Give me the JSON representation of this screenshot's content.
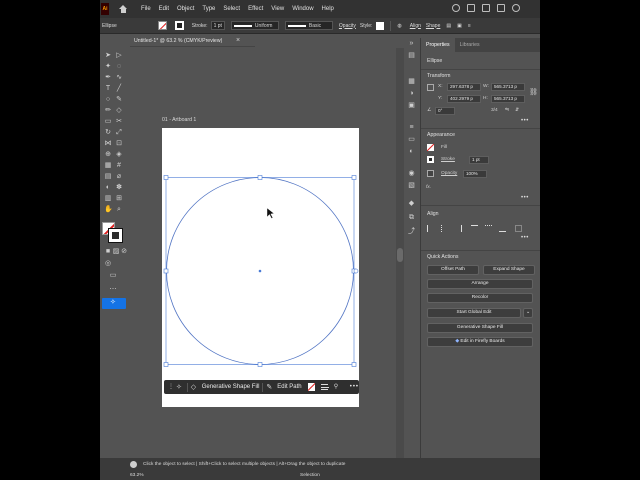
{
  "menu": {
    "app_logo": "Ai",
    "items": [
      "File",
      "Edit",
      "Object",
      "Type",
      "Select",
      "Effect",
      "View",
      "Window",
      "Help"
    ]
  },
  "control_bar": {
    "object_type": "Ellipse",
    "stroke_label": "Stroke:",
    "stroke_weight": "1 pt",
    "profile": "Uniform",
    "brush": "Basic",
    "opacity_label": "Opacity",
    "style_label": "Style:",
    "align_label": "Align",
    "shape_label": "Shape"
  },
  "document": {
    "tab_title": "Untitled-1* @ 63.2 % (CMYK/Preview)",
    "artboard_label": "01 - Artboard 1"
  },
  "context_bar": {
    "generative_fill": "Generative Shape Fill",
    "edit_path": "Edit Path",
    "more": "•••"
  },
  "properties": {
    "tabs": [
      "Properties",
      "Libraries"
    ],
    "object_type": "Ellipse",
    "transform": {
      "title": "Transform",
      "x_label": "X:",
      "x_value": "297.6378 p",
      "y_label": "Y:",
      "y_value": "402.2979 p",
      "w_label": "W:",
      "w_value": "565.3713 p",
      "h_label": "H:",
      "h_value": "565.3713 p",
      "angle_value": "0°",
      "ratio_text": "3/4"
    },
    "appearance": {
      "title": "Appearance",
      "fill_label": "Fill",
      "stroke_label": "Stroke",
      "stroke_value": "1 pt",
      "opacity_label": "Opacity",
      "opacity_value": "100%",
      "fx_label": "fx."
    },
    "align": {
      "title": "Align"
    },
    "quick_actions": {
      "title": "Quick Actions",
      "offset_path": "Offset Path",
      "expand_shape": "Expand Shape",
      "arrange": "Arrange",
      "recolor": "Recolor",
      "start_global_edit": "Start Global Edit",
      "generative_shape_fill": "Generative Shape Fill",
      "edit_in_firefly": "Edit in Firefly Boards"
    },
    "more": "•••"
  },
  "status_bar": {
    "hint": "Click the object to select  |  Shift+Click to select multiple objects  |  Alt+Drag the object to duplicate",
    "zoom": "63.2%",
    "mode": "Selection"
  },
  "colors": {
    "accent": "#1473e6",
    "selection": "#4a7bd6",
    "panel": "#535353",
    "chrome": "#323232"
  }
}
